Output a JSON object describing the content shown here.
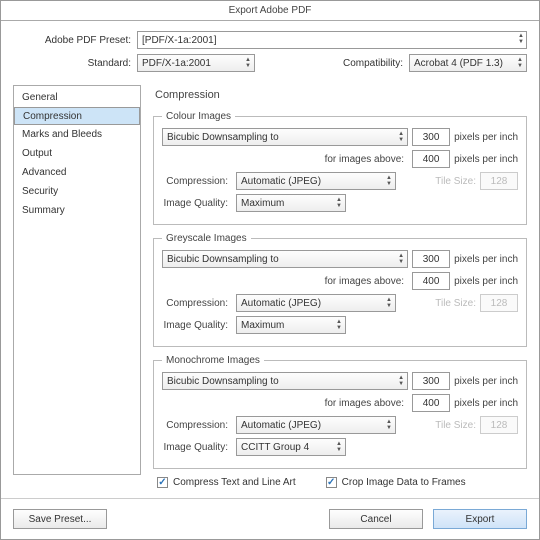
{
  "window": {
    "title": "Export Adobe PDF"
  },
  "top": {
    "preset_label": "Adobe PDF Preset:",
    "preset_value": "[PDF/X-1a:2001]",
    "standard_label": "Standard:",
    "standard_value": "PDF/X-1a:2001",
    "compat_label": "Compatibility:",
    "compat_value": "Acrobat 4 (PDF 1.3)"
  },
  "sidebar": {
    "items": [
      "General",
      "Compression",
      "Marks and Bleeds",
      "Output",
      "Advanced",
      "Security",
      "Summary"
    ]
  },
  "main": {
    "heading": "Compression",
    "colour": {
      "legend": "Colour Images",
      "method": "Bicubic Downsampling to",
      "dpi": "300",
      "unit": "pixels per inch",
      "for_above_label": "for images above:",
      "for_above": "400",
      "unit2": "pixels per inch",
      "compression_label": "Compression:",
      "compression": "Automatic (JPEG)",
      "tile_label": "Tile Size:",
      "tile": "128",
      "iq_label": "Image Quality:",
      "iq": "Maximum"
    },
    "grey": {
      "legend": "Greyscale Images",
      "method": "Bicubic Downsampling to",
      "dpi": "300",
      "unit": "pixels per inch",
      "for_above_label": "for images above:",
      "for_above": "400",
      "unit2": "pixels per inch",
      "compression_label": "Compression:",
      "compression": "Automatic (JPEG)",
      "tile_label": "Tile Size:",
      "tile": "128",
      "iq_label": "Image Quality:",
      "iq": "Maximum"
    },
    "mono": {
      "legend": "Monochrome Images",
      "method": "Bicubic Downsampling to",
      "dpi": "300",
      "unit": "pixels per inch",
      "for_above_label": "for images above:",
      "for_above": "400",
      "unit2": "pixels per inch",
      "compression_label": "Compression:",
      "compression": "Automatic (JPEG)",
      "tile_label": "Tile Size:",
      "tile": "128",
      "iq_label": "Image Quality:",
      "iq": "CCITT Group 4"
    },
    "check1": "Compress Text and Line Art",
    "check2": "Crop Image Data to Frames"
  },
  "bottom": {
    "save_preset": "Save Preset...",
    "cancel": "Cancel",
    "export": "Export"
  }
}
